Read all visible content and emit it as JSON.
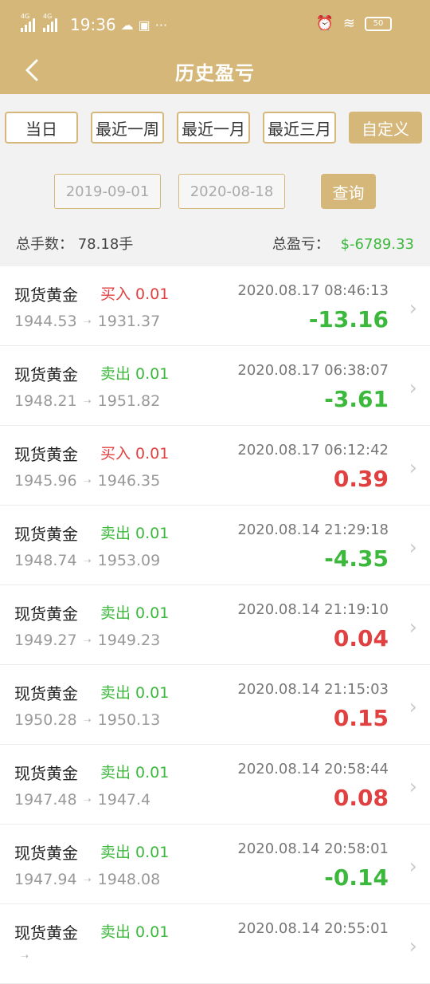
{
  "status": {
    "sim1": "4G",
    "sim2": "4G",
    "time": "19:36",
    "battery": "50"
  },
  "header": {
    "title": "历史盈亏"
  },
  "filters": [
    "当日",
    "最近一周",
    "最近一月",
    "最近三月",
    "自定义"
  ],
  "dates": {
    "start": "2019-09-01",
    "end": "2020-08-18",
    "query": "查询"
  },
  "summary": {
    "lots_label": "总手数：",
    "lots_value": "78.18手",
    "pl_label": "总盈亏：",
    "pl_value": "$-6789.33"
  },
  "trades": [
    {
      "product": "现货黄金",
      "dir": "买入 0.01",
      "type": "buy",
      "open": "1944.53",
      "close": "1931.37",
      "time": "2020.08.17 08:46:13",
      "pl": "-13.16",
      "sign": "neg"
    },
    {
      "product": "现货黄金",
      "dir": "卖出 0.01",
      "type": "sell",
      "open": "1948.21",
      "close": "1951.82",
      "time": "2020.08.17 06:38:07",
      "pl": "-3.61",
      "sign": "neg"
    },
    {
      "product": "现货黄金",
      "dir": "买入 0.01",
      "type": "buy",
      "open": "1945.96",
      "close": "1946.35",
      "time": "2020.08.17 06:12:42",
      "pl": "0.39",
      "sign": "pos"
    },
    {
      "product": "现货黄金",
      "dir": "卖出 0.01",
      "type": "sell",
      "open": "1948.74",
      "close": "1953.09",
      "time": "2020.08.14 21:29:18",
      "pl": "-4.35",
      "sign": "neg"
    },
    {
      "product": "现货黄金",
      "dir": "卖出 0.01",
      "type": "sell",
      "open": "1949.27",
      "close": "1949.23",
      "time": "2020.08.14 21:19:10",
      "pl": "0.04",
      "sign": "pos"
    },
    {
      "product": "现货黄金",
      "dir": "卖出 0.01",
      "type": "sell",
      "open": "1950.28",
      "close": "1950.13",
      "time": "2020.08.14 21:15:03",
      "pl": "0.15",
      "sign": "pos"
    },
    {
      "product": "现货黄金",
      "dir": "卖出 0.01",
      "type": "sell",
      "open": "1947.48",
      "close": "1947.4",
      "time": "2020.08.14 20:58:44",
      "pl": "0.08",
      "sign": "pos"
    },
    {
      "product": "现货黄金",
      "dir": "卖出 0.01",
      "type": "sell",
      "open": "1947.94",
      "close": "1948.08",
      "time": "2020.08.14 20:58:01",
      "pl": "-0.14",
      "sign": "neg"
    },
    {
      "product": "现货黄金",
      "dir": "卖出 0.01",
      "type": "sell",
      "open": "",
      "close": "",
      "time": "2020.08.14 20:55:01",
      "pl": "",
      "sign": "pos"
    }
  ],
  "icons": {
    "back": "chevron-left-icon",
    "row_arrow": "chevron-right-icon",
    "price_arrow": "right-arrow-icon"
  },
  "colors": {
    "gold": "#d5b77a",
    "loss": "#3cb93c",
    "gain": "#e04040"
  }
}
